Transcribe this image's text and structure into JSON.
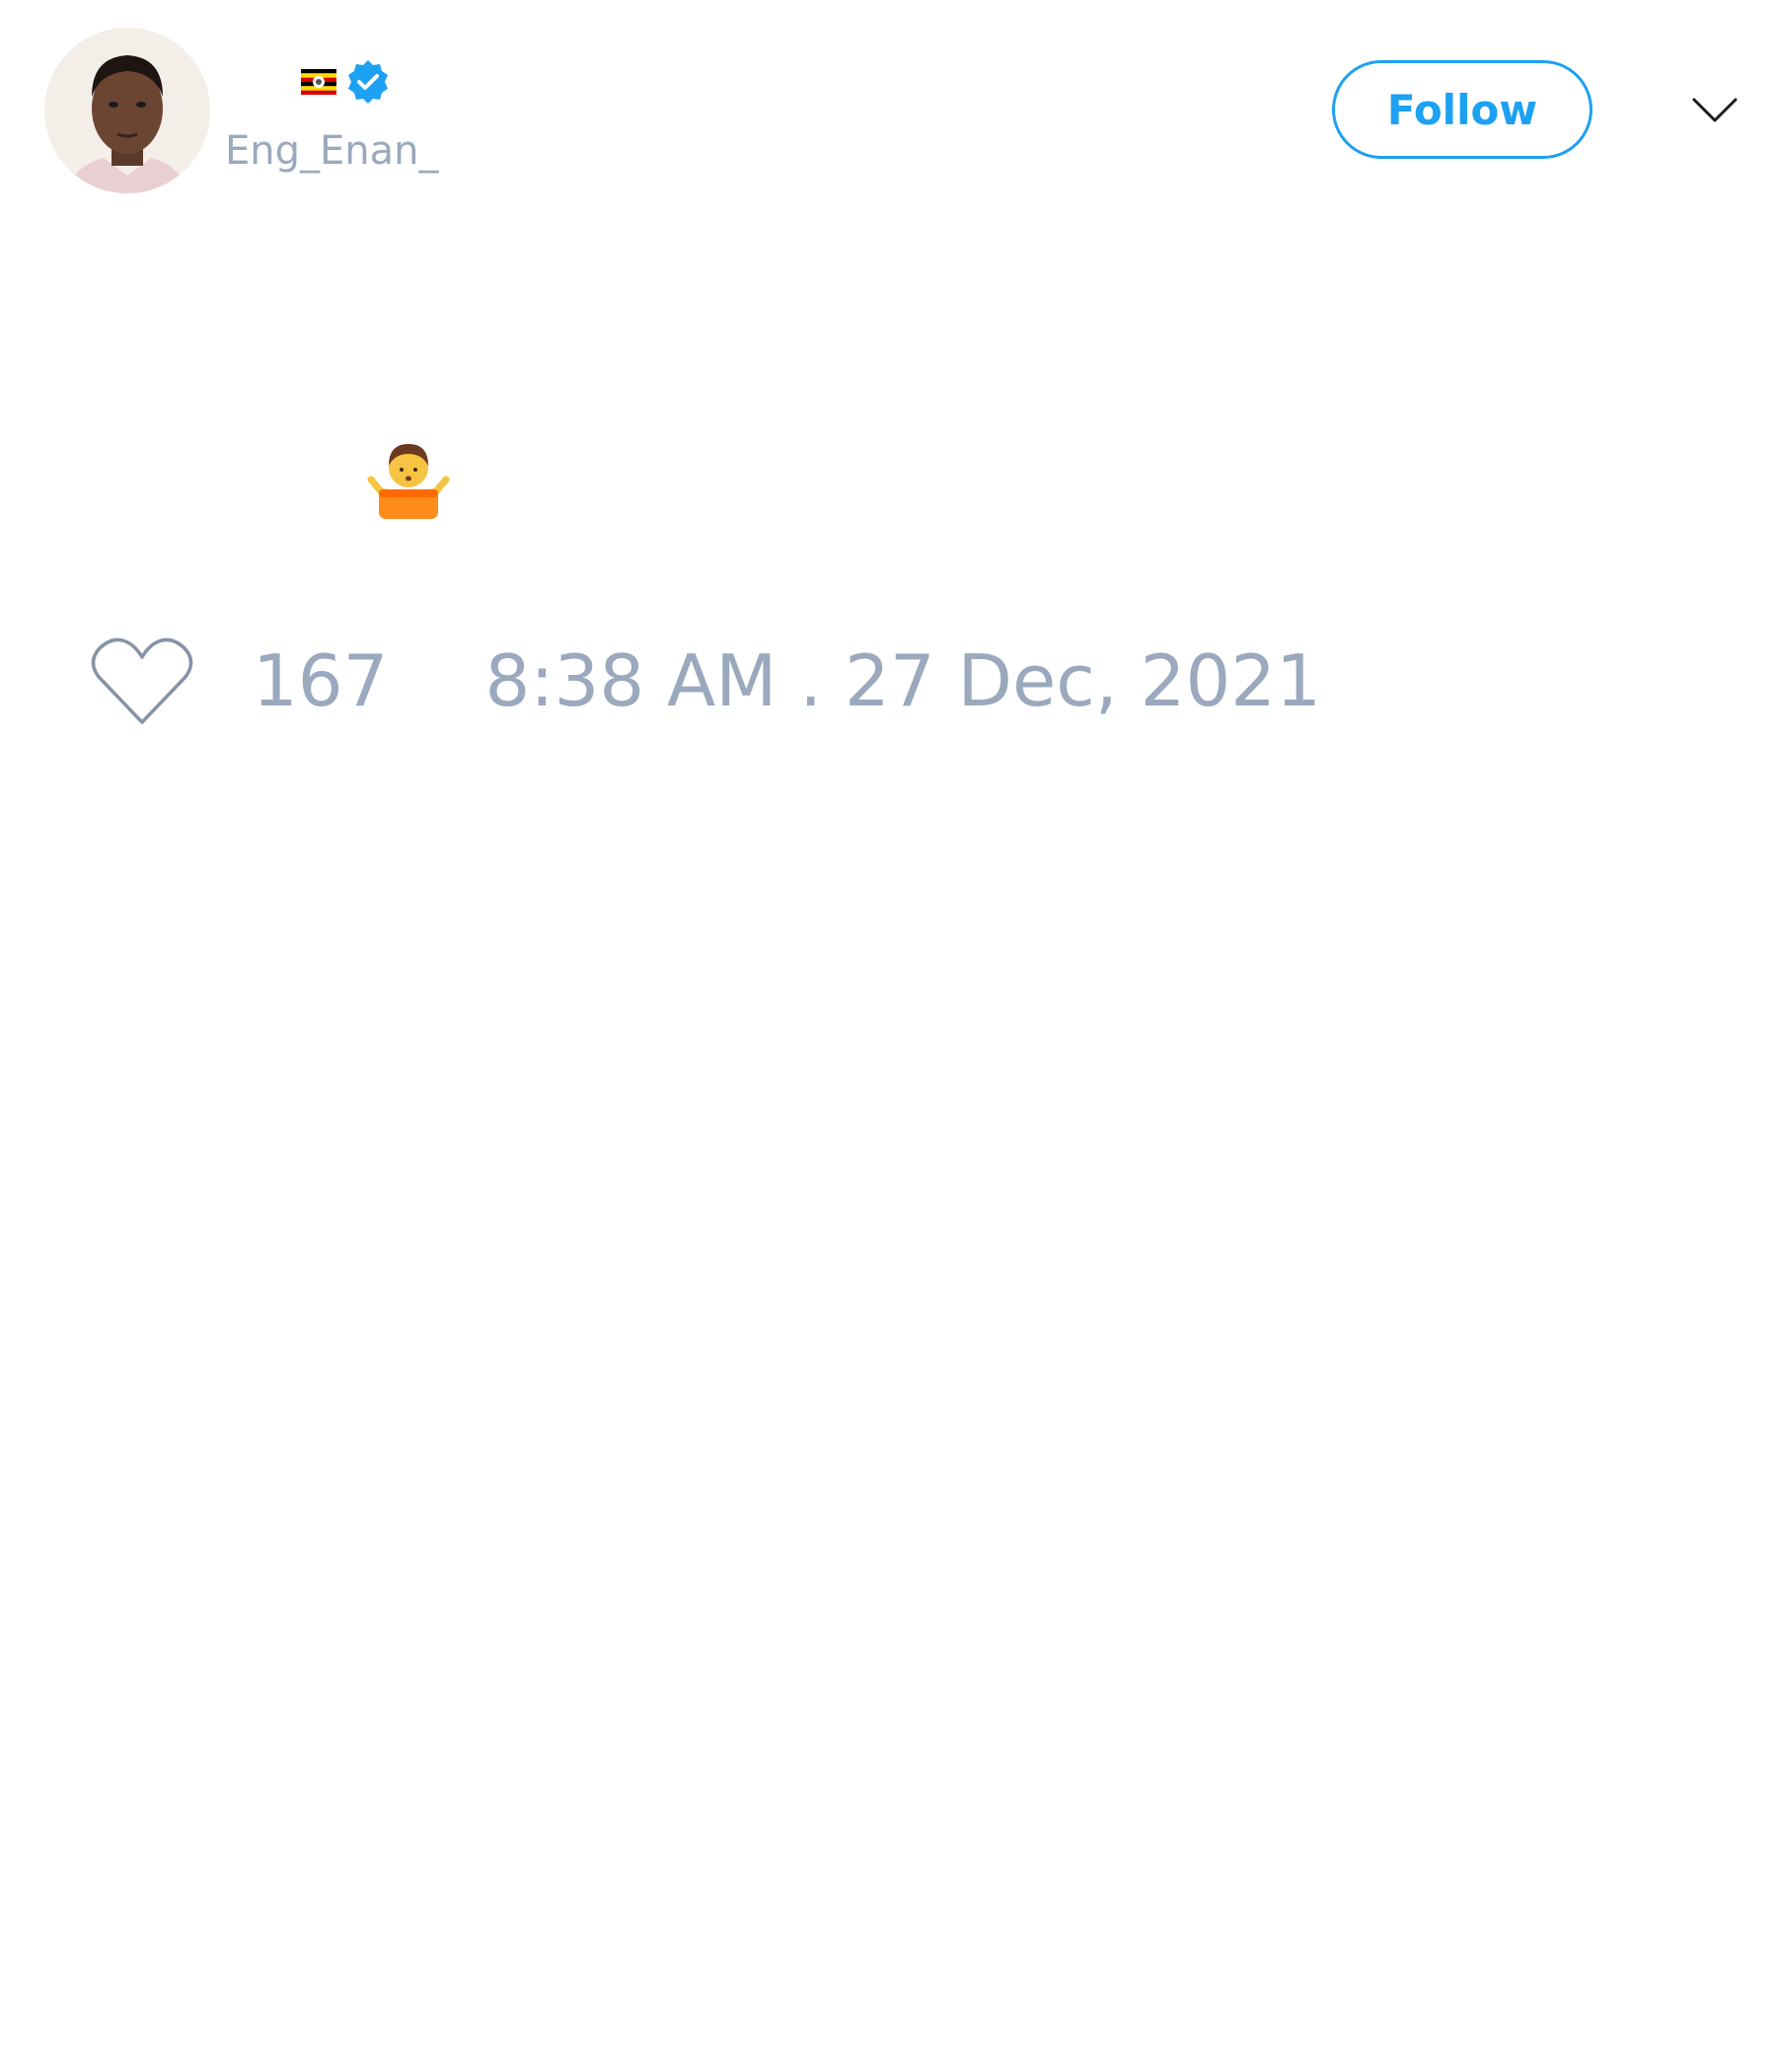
{
  "tweet": {
    "author": {
      "avatar_icon": "profile-photo",
      "flag_icon": "uganda-flag-icon",
      "verified_icon": "verified-badge-icon",
      "handle": "Eng_Enan_"
    },
    "follow_label": "Follow",
    "menu_icon": "chevron-down-icon",
    "body": {
      "emoji": "🤷"
    },
    "likes": {
      "icon": "heart-outline-icon",
      "count": "167"
    },
    "timestamp": "8:38 AM . 27 Dec, 2021"
  },
  "colors": {
    "accent": "#1da1f2",
    "muted_text": "#9aa9bd",
    "background": "#ffffff"
  }
}
